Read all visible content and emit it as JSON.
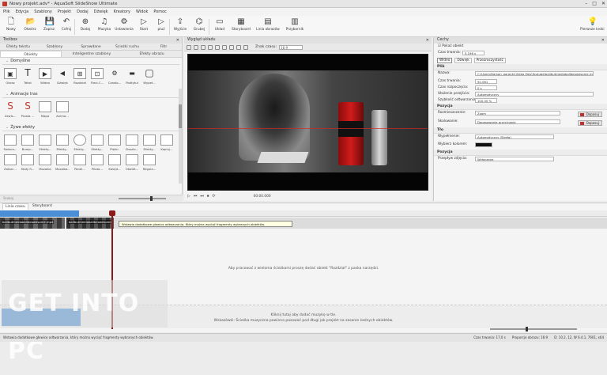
{
  "window": {
    "title": "Nowy projekt.adv* - AquaSoft SlideShow Ultimate",
    "controls": [
      "–",
      "□",
      "✕"
    ]
  },
  "menu": [
    "Plik",
    "Edycja",
    "Szablony",
    "Projekt",
    "Dodaj",
    "Dźwięk",
    "Kreatory",
    "Widok",
    "Pomoc"
  ],
  "ribbon": {
    "buttons": [
      {
        "label": "Nowy",
        "icon": "new-icon",
        "glyph": "🗋"
      },
      {
        "label": "Otwórz",
        "icon": "open-icon",
        "glyph": "📂"
      },
      {
        "label": "Zapisz",
        "icon": "save-icon",
        "glyph": "💾"
      },
      {
        "label": "Cofnij",
        "icon": "undo-icon",
        "glyph": "↶"
      },
      {
        "label": "Dodaj",
        "icon": "add-icon",
        "glyph": "⊕"
      },
      {
        "label": "Muzyka",
        "icon": "music-icon",
        "glyph": "♫"
      },
      {
        "label": "Ustawienia",
        "icon": "settings-icon",
        "glyph": "⚙"
      },
      {
        "label": "Start",
        "icon": "play-icon",
        "glyph": "▷"
      },
      {
        "label": "pluż",
        "icon": "play-from-icon",
        "glyph": "▷"
      },
      {
        "label": "Wyjście",
        "icon": "output-icon",
        "glyph": "⇪"
      },
      {
        "label": "Grubej",
        "icon": "glasses-icon",
        "glyph": "⌬"
      },
      {
        "label": "Układ",
        "icon": "layout-icon",
        "glyph": "▭"
      },
      {
        "label": "Storyboard",
        "icon": "storyboard-icon",
        "glyph": "▦"
      },
      {
        "label": "Linia obrazów",
        "icon": "timeline-icon",
        "glyph": "▤"
      },
      {
        "label": "Przybornik",
        "icon": "toolbox-icon",
        "glyph": "▥"
      }
    ],
    "help": {
      "label": "Pierwsze kroki",
      "glyph": "💡"
    }
  },
  "toolbox": {
    "title": "Toolbox",
    "tabs_top": [
      "Efekty tekstu",
      "Szablony",
      "Sprawdane",
      "Ścieżki ruchu",
      "Filtr"
    ],
    "tabs": [
      "Obiekty",
      "Inteligentne szablony",
      "Efekty obrazu"
    ],
    "sections": {
      "default": {
        "title": "Domyślne",
        "items": [
          {
            "name": "Obraz",
            "glyph": "▣"
          },
          {
            "name": "Tekst",
            "glyph": "T"
          },
          {
            "name": "Wideo",
            "glyph": "▶"
          },
          {
            "name": "Dźwięk",
            "glyph": "◀"
          },
          {
            "name": "Rozdział",
            "glyph": "⊞"
          },
          {
            "name": "Flexi-C...",
            "glyph": "⊡"
          },
          {
            "name": "Czasto...",
            "glyph": "⚙"
          },
          {
            "name": "Podtytuł",
            "glyph": "▬"
          },
          {
            "name": "Wypeł...",
            "glyph": "▢"
          }
        ]
      },
      "tracks": {
        "title": "Animacje tras",
        "items": [
          {
            "name": "Uzwis...",
            "glyph": "S"
          },
          {
            "name": "Prosta ...",
            "glyph": "S"
          },
          {
            "name": "Mapa",
            "glyph": "▦"
          },
          {
            "name": "Anima...",
            "glyph": "▦"
          }
        ]
      },
      "live": {
        "title": "Żywe efekty",
        "items": [
          {
            "name": "Świeca...",
            "glyph": "▢"
          },
          {
            "name": "Bump...",
            "glyph": "▢"
          },
          {
            "name": "Efekty...",
            "glyph": "▢"
          },
          {
            "name": "Efekty...",
            "glyph": "▢"
          },
          {
            "name": "Efekty...",
            "glyph": "◯"
          },
          {
            "name": "Efekty...",
            "glyph": "▢"
          },
          {
            "name": "Piękn.",
            "glyph": "▢"
          },
          {
            "name": "Duszlo...",
            "glyph": "▢"
          },
          {
            "name": "Efekty...",
            "glyph": "▢"
          },
          {
            "name": "Kopiuj...",
            "glyph": "▢"
          }
        ],
        "items2": [
          {
            "name": "Zatarc...",
            "glyph": "▢"
          },
          {
            "name": "Stały fi...",
            "glyph": "▢"
          },
          {
            "name": "Mozaika",
            "glyph": "▢"
          },
          {
            "name": "Mozaika...",
            "glyph": "▢"
          },
          {
            "name": "Panel...",
            "glyph": "▢"
          },
          {
            "name": "Pilota...",
            "glyph": "▢"
          },
          {
            "name": "Kalejd...",
            "glyph": "▢"
          },
          {
            "name": "Oświet...",
            "glyph": "▢"
          },
          {
            "name": "Regula...",
            "glyph": "▢"
          }
        ]
      }
    },
    "footer": "Szukaj"
  },
  "preview": {
    "title": "Wygląd układu",
    "zoom_label": "Znak czasu:",
    "zoom_value": "16:9",
    "time": "00:00.000"
  },
  "properties": {
    "title": "Cechy",
    "show_object": "Pokaż obiekt",
    "duration_label": "Czas trwania:",
    "duration_value": "5.196 s",
    "tabs": [
      "Wideo",
      "Dźwięk",
      "Przezroczystość"
    ],
    "file_section": "Plik",
    "name_label": "Nazwa:",
    "name_value": "C:\\Users\\Darsan_garanty\\Video files\\Youtube\\ballbutmediaballbeawesome.mp4",
    "length_label": "Czas trwania:",
    "length_value": "92.061",
    "start_label": "Czas rozpoczęcia:",
    "start_value": "0 s",
    "speed_label": "Ułożenie przejścia:",
    "speed_value": "Automatyczny",
    "playback_label": "Szybkość odtwarzania:",
    "playback_value": "100,00 %",
    "position_section": "Pozycja",
    "align_label": "Rozmieszczenie:",
    "align_value": "Zoom",
    "scale_label": "Skalowanie:",
    "scale_value": "Dopasowanie przycinanie",
    "fit_button": "Dopasuj",
    "bg_section": "Tło",
    "fill_label": "Wypełnienie:",
    "fill_value": "Automatyczny (Strefa)",
    "color_label": "Wybierz kolorem:",
    "pos2_section": "Pozycja",
    "extra_label": "Przepływ zdjęcia:",
    "extra_value": "Wyłączone"
  },
  "timeline": {
    "tabs": [
      "Linia czasu",
      "Storyboard"
    ],
    "clip1": "ballbutmediaballbeawesome.mp4",
    "clip2": "ballbutmediaballbeawesome",
    "tooltip": "Wstawia dodatkowe głowicę odtwarzania. Który można wyciąć fragmenty wybranych obiektów.",
    "message": "Aby pracować z wieloma ścieżkami proszę dodać obiekt \"Rozdział\" z paska narzędzi.",
    "music_line1": "Kliknij tutaj aby dodać muzykę w tle.",
    "music_line2": "Wskazówki: Ścieżka muzyczna powinna pasować pod długi jak projekt na zasanie żadnych obiektów."
  },
  "watermark": "GET INTO PC",
  "status": {
    "left": "Wstawia dodatkowe głowicę odtwarzania, który można wyciąć fragmenty wybranych obiektów.",
    "duration": "Czas trwania: 17,0 s",
    "properties": "Proporcje obrazu: 16:9",
    "version": "D: 10.2, 12, W 6.4.1, 7601, x64"
  }
}
